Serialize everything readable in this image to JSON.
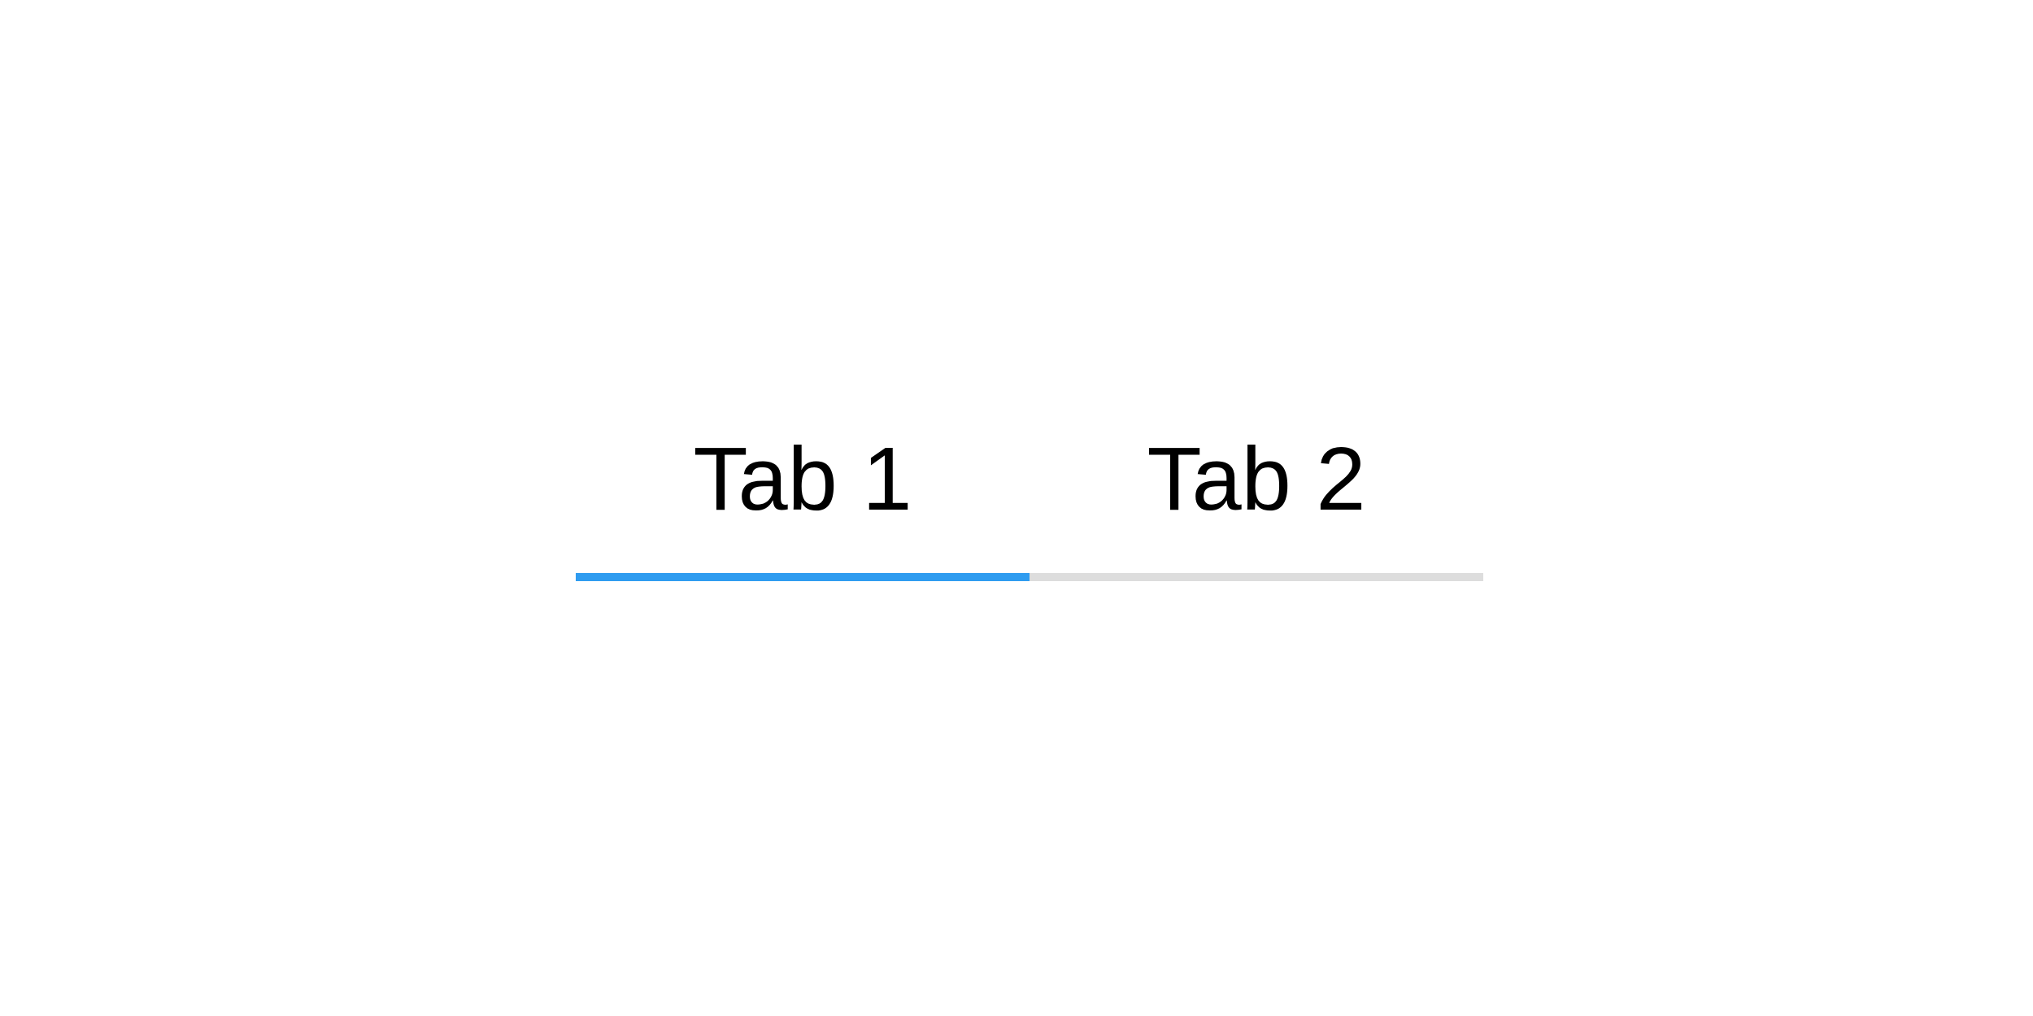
{
  "tabs": [
    {
      "label": "Tab 1",
      "active": true
    },
    {
      "label": "Tab 2",
      "active": false
    }
  ],
  "colors": {
    "active_indicator": "#2f9cf0",
    "inactive_indicator": "#dddddd",
    "text": "#000000",
    "background": "#ffffff"
  }
}
